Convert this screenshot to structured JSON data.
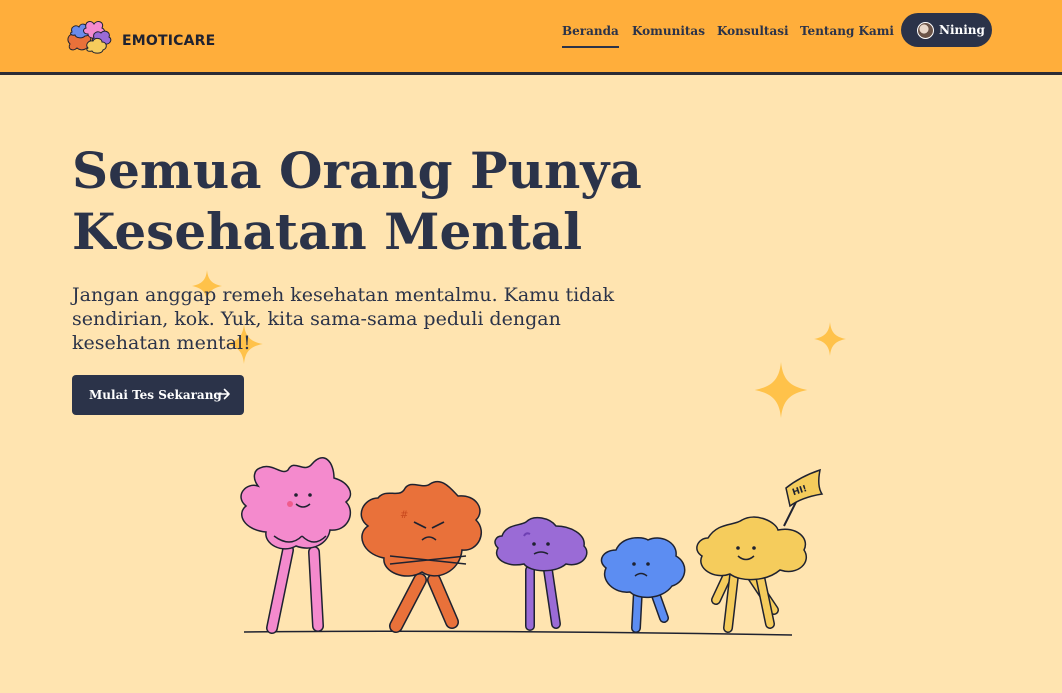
{
  "brand": {
    "name": "EMOTICARE"
  },
  "nav": {
    "items": [
      {
        "label": "Beranda",
        "active": true
      },
      {
        "label": "Komunitas",
        "active": false
      },
      {
        "label": "Konsultasi",
        "active": false
      },
      {
        "label": "Tentang Kami",
        "active": false
      }
    ],
    "profile": {
      "name": "Nining"
    }
  },
  "hero": {
    "title_lines": [
      "Semua Orang Punya",
      "Kesehatan Mental"
    ],
    "subtitle_lines": [
      "Jangan anggap remeh kesehatan mentalmu. Kamu tidak",
      "sendirian, kok. Yuk, kita sama-sama peduli dengan",
      "kesehatan mental!"
    ],
    "cta_label": "Mulai Tes Sekarang"
  },
  "illustration": {
    "flag_text": "HI!"
  },
  "colors": {
    "header_bg": "#FFAE3B",
    "page_bg": "#FFE4B0",
    "primary": "#2B3349",
    "sparkle": "#FFC24A"
  },
  "icons": {
    "cta": "arrow-right-icon",
    "decor": "sparkle-icon"
  }
}
